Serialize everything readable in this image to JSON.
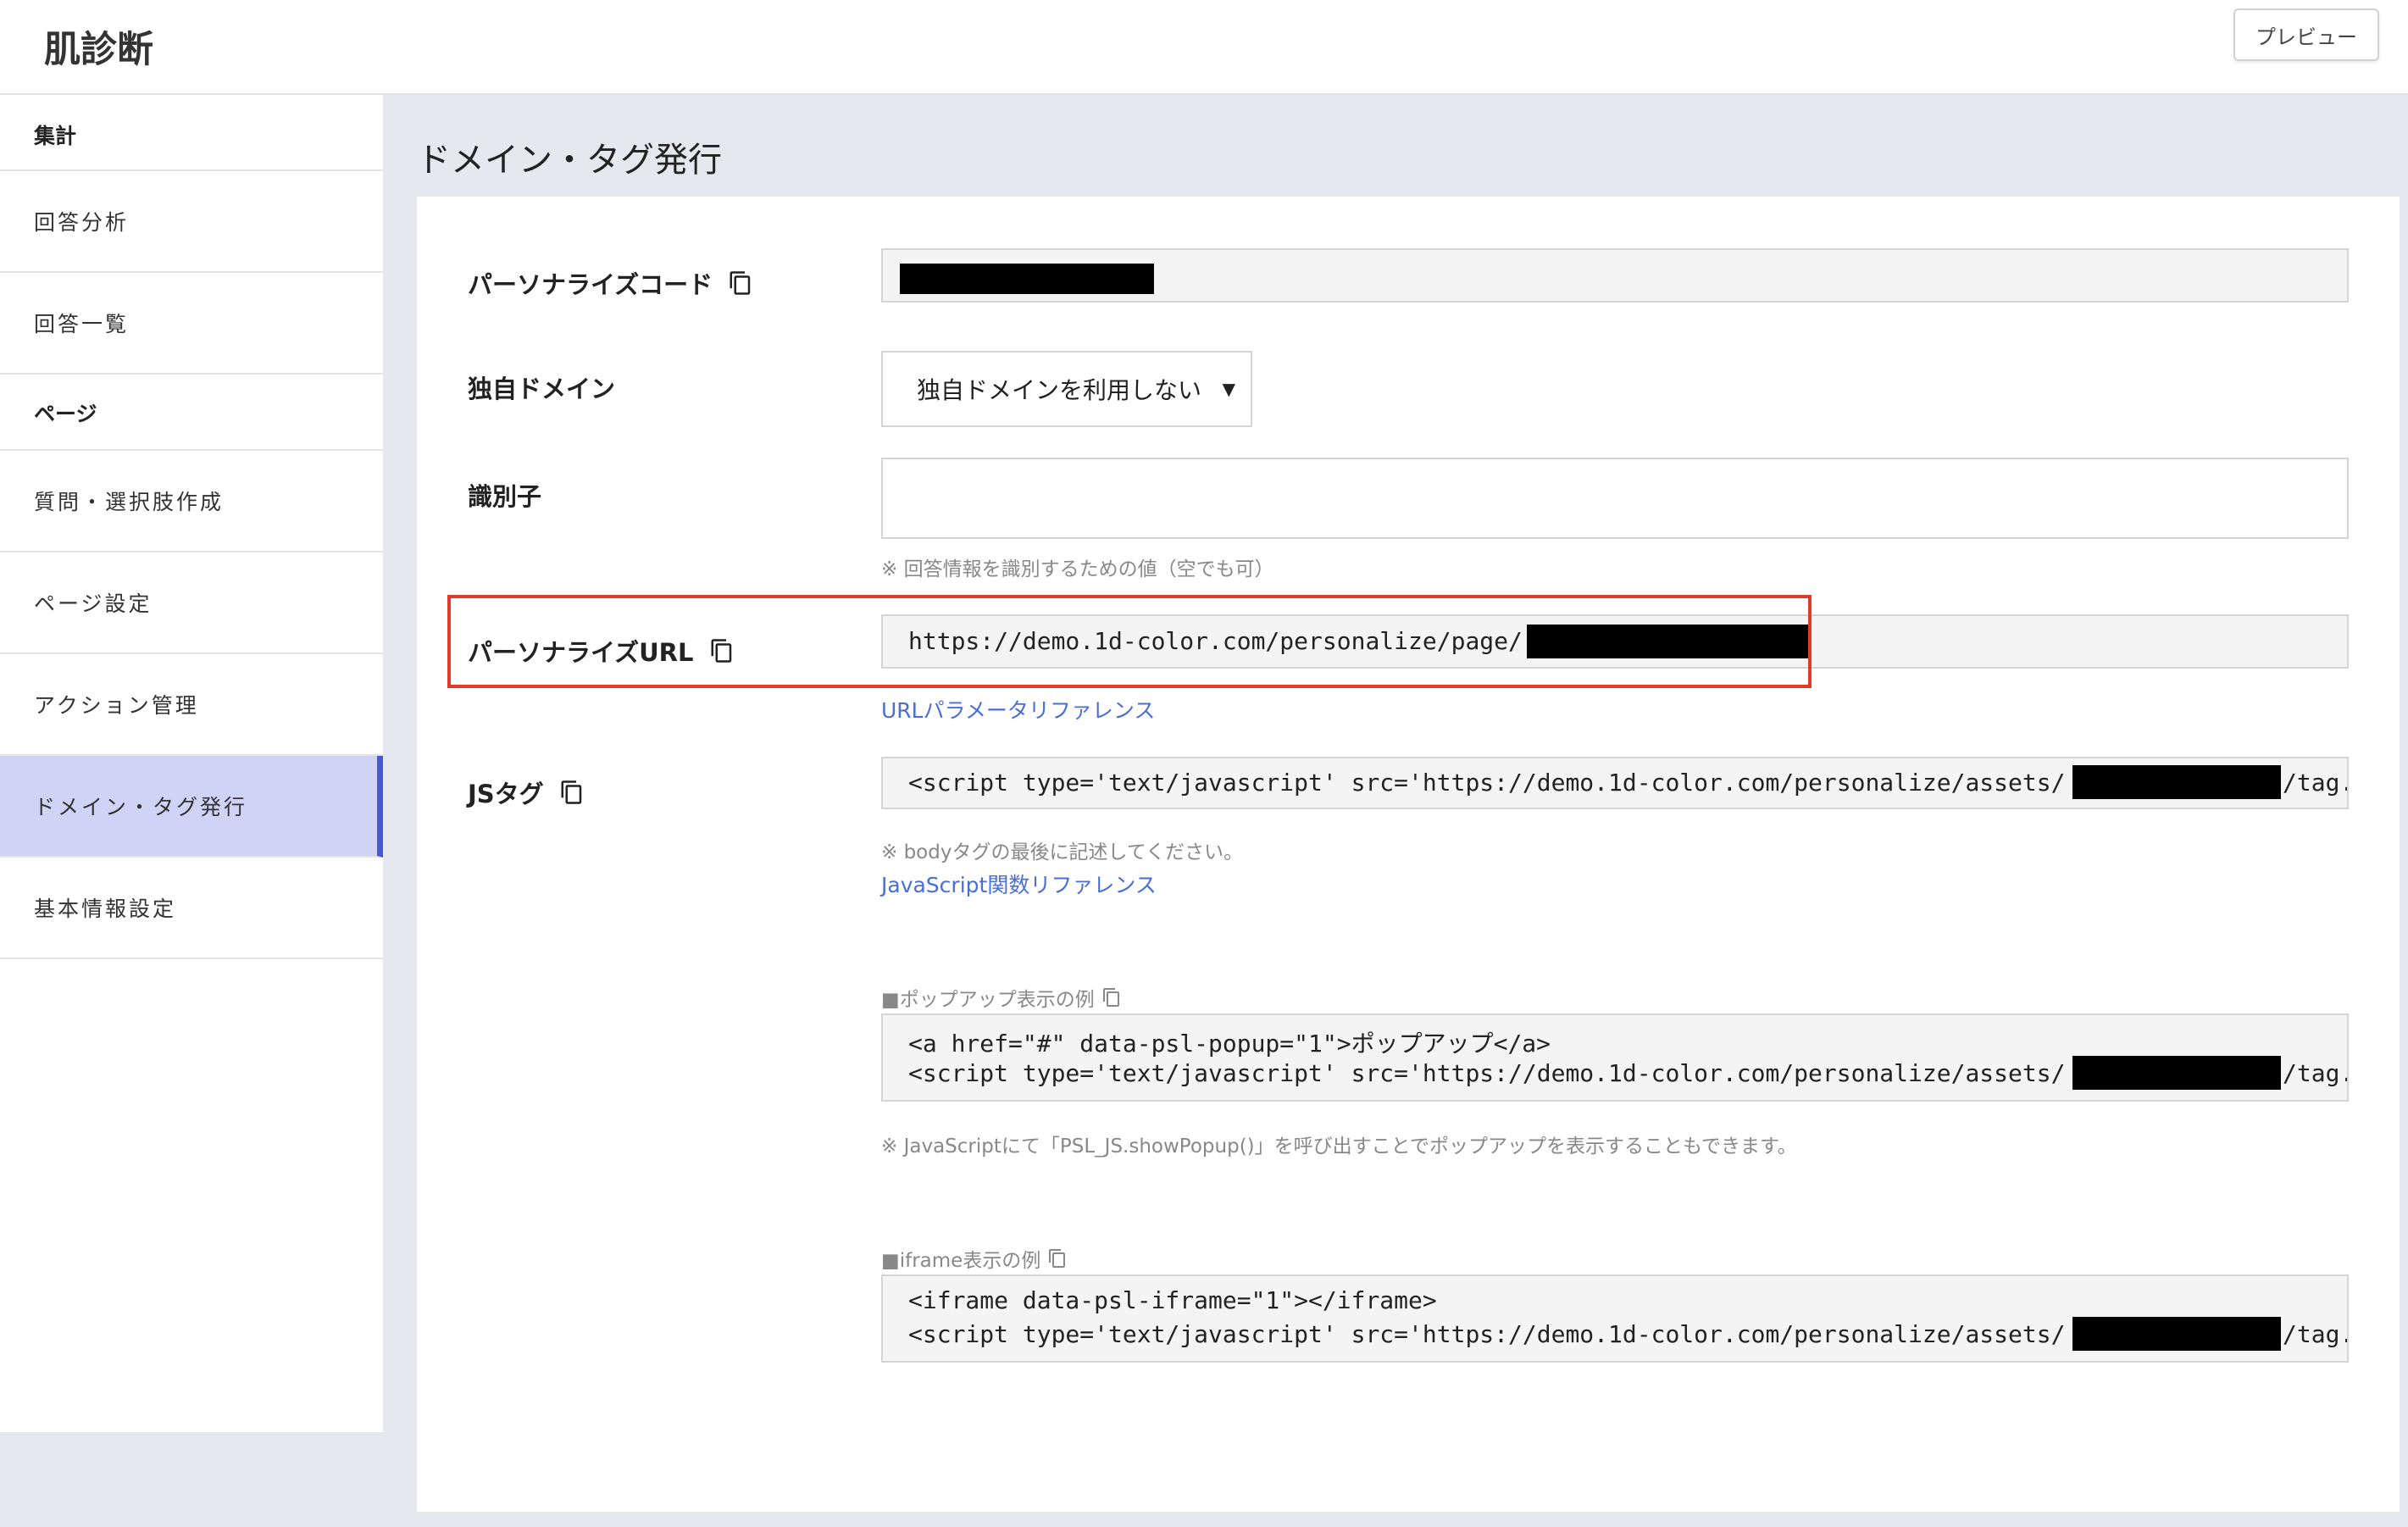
{
  "app": {
    "title": "肌診断"
  },
  "header": {
    "preview_label": "プレビュー"
  },
  "sidebar": {
    "sections": [
      {
        "label": "集計"
      },
      {
        "label": "ページ"
      }
    ],
    "items": [
      {
        "label": "回答分析"
      },
      {
        "label": "回答一覧"
      },
      {
        "label": "質問・選択肢作成"
      },
      {
        "label": "ページ設定"
      },
      {
        "label": "アクション管理"
      },
      {
        "label": "ドメイン・タグ発行",
        "active": true
      },
      {
        "label": "基本情報設定"
      }
    ]
  },
  "page": {
    "title": "ドメイン・タグ発行"
  },
  "form": {
    "personalize_code": {
      "label": "パーソナライズコード",
      "value": ""
    },
    "custom_domain": {
      "label": "独自ドメイン",
      "selected": "独自ドメインを利用しない"
    },
    "identifier": {
      "label": "識別子",
      "value": "",
      "hint": "※ 回答情報を識別するための値（空でも可）"
    },
    "personalize_url": {
      "label": "パーソナライズURL",
      "value": "https://demo.1d-color.com/personalize/page/",
      "link": "URLパラメータリファレンス"
    },
    "js_tag": {
      "label": "JSタグ",
      "value": "<script type='text/javascript' src='https://demo.1d-color.com/personalize/assets/",
      "value_tail": "/tag.",
      "hint": "※ bodyタグの最後に記述してください。",
      "link": "JavaScript関数リファレンス"
    },
    "popup_example": {
      "label": "■ポップアップ表示の例",
      "line1": "<a href=\"#\" data-psl-popup=\"1\">ポップアップ</a>",
      "line2": "<script type='text/javascript' src='https://demo.1d-color.com/personalize/assets/",
      "line2_tail": "/tag.",
      "hint": "※ JavaScriptにて「PSL_JS.showPopup()」を呼び出すことでポップアップを表示することもできます。"
    },
    "iframe_example": {
      "label": "■iframe表示の例",
      "line1": "<iframe data-psl-iframe=\"1\"></iframe>",
      "line2": "<script type='text/javascript' src='https://demo.1d-color.com/personalize/assets/",
      "line2_tail": "/tag."
    }
  },
  "colors": {
    "accent": "#4a57d6",
    "active_bg": "#cfd3f5",
    "link": "#4a6ed8",
    "highlight": "#e03c2c"
  },
  "icons": [
    "copy-icon",
    "chevron-down-icon"
  ]
}
